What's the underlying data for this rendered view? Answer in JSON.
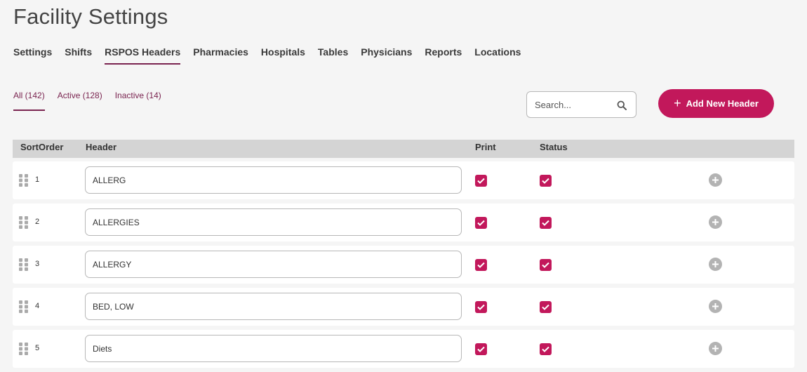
{
  "page": {
    "title": "Facility Settings"
  },
  "tabs": [
    {
      "label": "Settings"
    },
    {
      "label": "Shifts"
    },
    {
      "label": "RSPOS Headers"
    },
    {
      "label": "Pharmacies"
    },
    {
      "label": "Hospitals"
    },
    {
      "label": "Tables"
    },
    {
      "label": "Physicians"
    },
    {
      "label": "Reports"
    },
    {
      "label": "Locations"
    }
  ],
  "active_tab": "RSPOS Headers",
  "subtabs": [
    {
      "label": "All (142)"
    },
    {
      "label": "Active (128)"
    },
    {
      "label": "Inactive (14)"
    }
  ],
  "active_subtab": "All (142)",
  "search": {
    "placeholder": "Search...",
    "value": ""
  },
  "add_button": {
    "label": "Add New Header"
  },
  "table": {
    "columns": {
      "sort_order": "SortOrder",
      "header": "Header",
      "print": "Print",
      "status": "Status"
    },
    "rows": [
      {
        "sort": "1",
        "header": "ALLERG",
        "print": true,
        "status": true
      },
      {
        "sort": "2",
        "header": "ALLERGIES",
        "print": true,
        "status": true
      },
      {
        "sort": "3",
        "header": "ALLERGY",
        "print": true,
        "status": true
      },
      {
        "sort": "4",
        "header": "BED, LOW",
        "print": true,
        "status": true
      },
      {
        "sort": "5",
        "header": "Diets",
        "print": true,
        "status": true
      }
    ]
  },
  "icons": {
    "drag": "drag-handle-icon",
    "search": "search-icon",
    "add_row": "plus-circle-icon",
    "check": "checkmark-icon"
  },
  "colors": {
    "accent": "#c2185b",
    "tab_underline": "#7a2450",
    "table_header_bg": "#d4d4d4",
    "page_bg": "#f5f5f5"
  }
}
